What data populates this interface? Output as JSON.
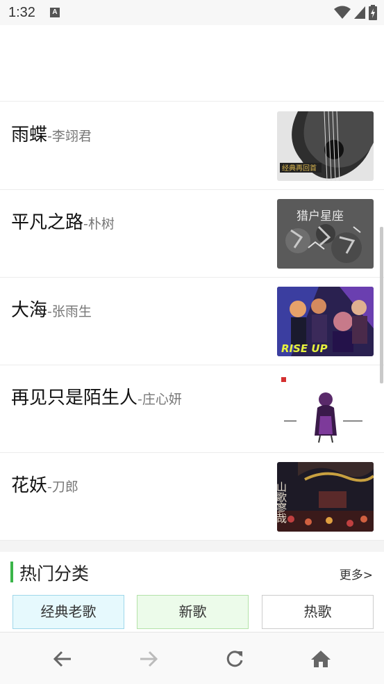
{
  "status_bar": {
    "time": "1:32",
    "notification_badge": "A",
    "icons": [
      "wifi-icon",
      "signal-icon",
      "battery-icon"
    ]
  },
  "songs": [
    {
      "title": "雨蝶",
      "artist": "-李翊君",
      "thumb_caption": "经典再回首"
    },
    {
      "title": "平凡之路",
      "artist": "-朴树",
      "thumb_caption": "猎户星座"
    },
    {
      "title": "大海",
      "artist": "-张雨生",
      "thumb_caption": "RISE UP"
    },
    {
      "title": "再见只是陌生人",
      "artist": "-庄心妍",
      "thumb_caption": ""
    },
    {
      "title": "花妖",
      "artist": "-刀郎",
      "thumb_caption": "山歌寥哉"
    }
  ],
  "hot_categories": {
    "title": "热门分类",
    "more_label": "更多>",
    "buttons": [
      {
        "label": "经典老歌",
        "color": "#e6f9fd"
      },
      {
        "label": "新歌",
        "color": "#ecfbea"
      },
      {
        "label": "热歌",
        "color": "#ffffff"
      }
    ]
  },
  "theme": {
    "accent": "#3bb54a"
  },
  "bottom_nav": [
    "back-icon",
    "forward-icon",
    "refresh-icon",
    "home-icon"
  ]
}
